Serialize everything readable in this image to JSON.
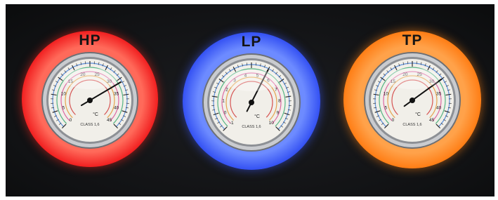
{
  "gauges": [
    {
      "id": "hp",
      "ring_label": "HP",
      "ring_color": "#f0191b",
      "class_text": "CLASS 1,6",
      "unit_text": "°C",
      "scale_numbers": [
        "0",
        "5",
        "10",
        "15",
        "20",
        "25",
        "30",
        "35",
        "40",
        "45"
      ],
      "needle_reading_fraction": 0.72
    },
    {
      "id": "lp",
      "ring_label": "LP",
      "ring_color": "#2f4cf2",
      "class_text": "CLASS 1,6",
      "unit_text": "°C",
      "scale_numbers": [
        "-1",
        "0",
        "1",
        "2",
        "3",
        "4",
        "5",
        "6",
        "7",
        "8",
        "9",
        "10"
      ],
      "needle_reading_fraction": 0.6
    },
    {
      "id": "tp",
      "ring_label": "TP",
      "ring_color": "#ff7a10",
      "class_text": "CLASS 1,6",
      "unit_text": "°C",
      "scale_numbers": [
        "0",
        "5",
        "10",
        "15",
        "20",
        "25",
        "30",
        "35",
        "40",
        "45"
      ],
      "needle_reading_fraction": 0.7
    }
  ]
}
